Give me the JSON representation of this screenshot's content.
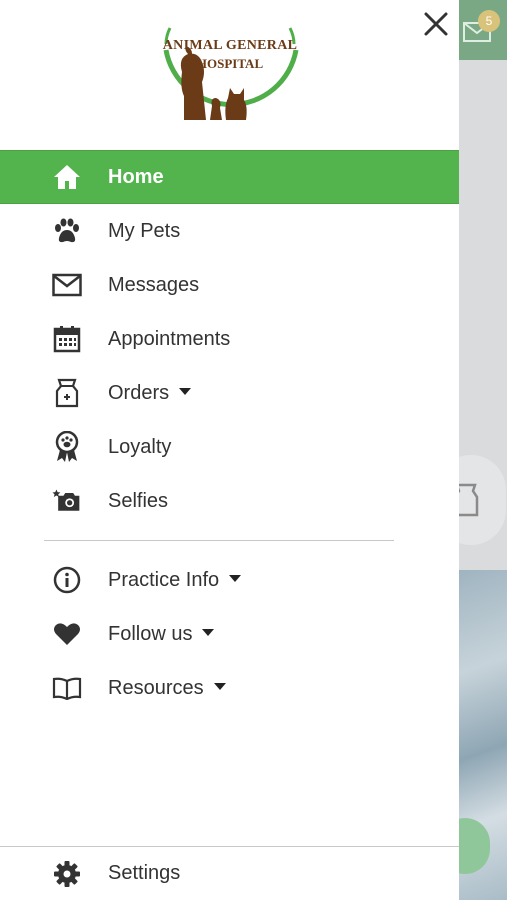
{
  "logo": {
    "line1": "ANIMAL GENERAL",
    "line2": "HOSPITAL"
  },
  "background": {
    "badge_count": "5"
  },
  "colors": {
    "accent": "#53b44e",
    "logo_brown": "#6b3a16",
    "text": "#333333"
  },
  "menu": {
    "items": [
      {
        "label": "Home",
        "icon": "home-icon",
        "active": true
      },
      {
        "label": "My Pets",
        "icon": "paw-icon"
      },
      {
        "label": "Messages",
        "icon": "envelope-icon"
      },
      {
        "label": "Appointments",
        "icon": "calendar-icon"
      },
      {
        "label": "Orders",
        "icon": "pet-food-bag-icon",
        "dropdown": true
      },
      {
        "label": "Loyalty",
        "icon": "award-ribbon-icon"
      },
      {
        "label": "Selfies",
        "icon": "camera-icon"
      }
    ],
    "secondary": [
      {
        "label": "Practice Info",
        "icon": "info-icon",
        "dropdown": true
      },
      {
        "label": "Follow us",
        "icon": "heart-icon",
        "dropdown": true
      },
      {
        "label": "Resources",
        "icon": "book-icon",
        "dropdown": true
      }
    ],
    "settings": {
      "label": "Settings",
      "icon": "gear-icon"
    }
  }
}
